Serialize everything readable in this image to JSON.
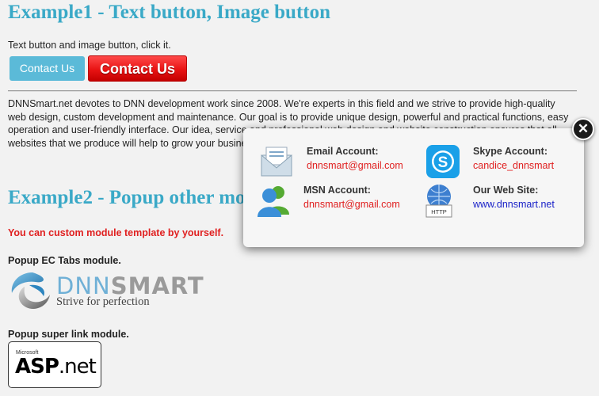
{
  "example1": {
    "heading": "Example1 - Text button, Image button",
    "intro": "Text button and image button, click it.",
    "text_button": "Contact Us",
    "image_button": "Contact Us",
    "description": "DNNSmart.net devotes to DNN development work since 2008. We're experts in this field and we strive to provide high-quality web design, custom development and maintenance. Our goal is to provide unique design, powerful and practical functions, easy operation and user-friendly interface. Our idea, service and professional web design and website construction ensures that all websites that we produce will help to grow your business."
  },
  "example2": {
    "heading": "Example2 - Popup other module",
    "red_note": "You can custom module template by yourself.",
    "ec_tabs_label": "Popup EC Tabs module.",
    "super_link_label": "Popup super link module."
  },
  "dnnsmart_logo": {
    "dnn": "DNN",
    "smart": "SMART",
    "slogan": "Strive for perfection"
  },
  "asp_logo": {
    "microsoft": "Microsoft",
    "asp": "ASP",
    "net": ".net"
  },
  "popup": {
    "close": "✕",
    "entries": [
      {
        "icon": "email-icon",
        "label": "Email Account:",
        "value": "dnnsmart@gmail.com"
      },
      {
        "icon": "skype-icon",
        "label": "Skype Account:",
        "value": "candice_dnnsmart"
      },
      {
        "icon": "msn-icon",
        "label": "MSN Account:",
        "value": "dnnsmart@gmail.com"
      },
      {
        "icon": "website-icon",
        "label": "Our Web Site:",
        "value": "www.dnnsmart.net",
        "icon_text": "HTTP"
      }
    ]
  }
}
